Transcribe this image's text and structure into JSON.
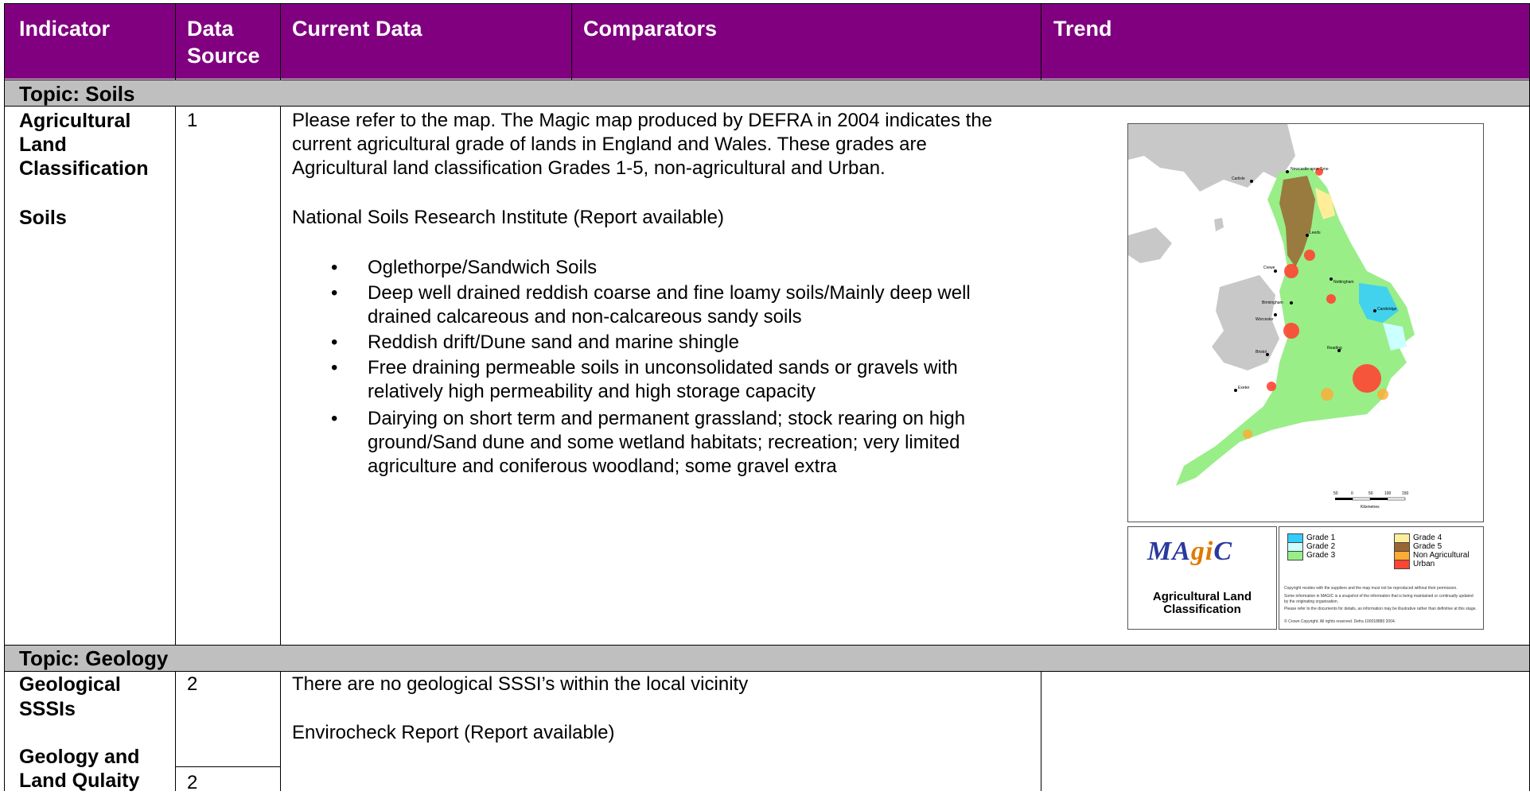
{
  "header": {
    "indicator": "Indicator",
    "data_source_line1": "Data",
    "data_source_line2": "Source",
    "current_data": "Current Data",
    "comparators": "Comparators",
    "trend": "Trend"
  },
  "soils": {
    "topic": "Topic: Soils",
    "indicator_alc_1": "Agricultural",
    "indicator_alc_2": "Land",
    "indicator_alc_3": "Classification",
    "indicator_soils": "Soils",
    "source": "1",
    "para1_line1": "Please refer to the map. The Magic map produced by DEFRA in 2004 indicates the",
    "para1_line2": "current agricultural grade of lands in England and Wales. These grades are",
    "para1_line3": "Agricultural land classification Grades 1-5, non-agricultural and Urban.",
    "para2": "National Soils Research Institute  (Report available)",
    "bullets": [
      {
        "l1": "Oglethorpe/Sandwich Soils",
        "l2": ""
      },
      {
        "l1": "Deep well drained reddish coarse and fine loamy soils/Mainly deep well",
        "l2": "drained calcareous and non-calcareous sandy soils"
      },
      {
        "l1": "Reddish drift/Dune sand and marine shingle",
        "l2": ""
      },
      {
        "l1": "Free draining permeable soils in unconsolidated sands or gravels with",
        "l2": "relatively high permeability and high storage capacity"
      },
      {
        "l1": "Dairying on short term and permanent grassland; stock rearing on high",
        "l2": "ground/Sand dune and some wetland habitats; recreation; very limited",
        "l3": "agriculture and coniferous woodland; some gravel extra"
      }
    ],
    "bullet_glyph": "•"
  },
  "map": {
    "cities": [
      {
        "name": "Newcastle upon Tyne"
      },
      {
        "name": "Carlisle"
      },
      {
        "name": "Leeds"
      },
      {
        "name": "Crewe"
      },
      {
        "name": "Nottingham"
      },
      {
        "name": "Birmingham"
      },
      {
        "name": "Cambridge"
      },
      {
        "name": "Worcester"
      },
      {
        "name": "Reading"
      },
      {
        "name": "Bristol"
      },
      {
        "name": "Exeter"
      }
    ],
    "scale_ticks": [
      "50",
      "0",
      "50",
      "100",
      "150"
    ],
    "scale_unit": "Kilometres",
    "logo_text_a": "MA",
    "logo_text_g": "gi",
    "logo_text_c": "C",
    "legend_title_1": "Agricultural Land",
    "legend_title_2": "Classification",
    "legend": [
      {
        "label": "Grade 1",
        "color": "#33ccff"
      },
      {
        "label": "Grade 2",
        "color": "#ccffff"
      },
      {
        "label": "Grade 3",
        "color": "#99ee88"
      },
      {
        "label": "Grade 4",
        "color": "#ffee99"
      },
      {
        "label": "Grade 5",
        "color": "#996633"
      },
      {
        "label": "Non Agricultural",
        "color": "#ffaa33"
      },
      {
        "label": "Urban",
        "color": "#ff4433"
      }
    ],
    "copyright_1": "Copyright resides with the suppliers and the map must not be reproduced without their permission.",
    "copyright_2": "Some information in MAGIC is a snapshot of the information that is being maintained or continually updated by the originating organisation.",
    "copyright_3": "Please refer to the documents for details, as information may be illustrative rather than definitive at this stage.",
    "copyright_4": "© Crown Copyright. All rights reserved. Defra 100018880 2004."
  },
  "geology": {
    "topic": "Topic: Geology",
    "indicator_sssi_1": "Geological",
    "indicator_sssi_2": "SSSIs",
    "indicator_land_1": "Geology and",
    "indicator_land_2": "Land Qulaity",
    "source_1": "2",
    "source_2": "2",
    "text_1": "There are no geological SSSI’s within the local vicinity",
    "text_2": "Envirocheck Report (Report available)"
  }
}
